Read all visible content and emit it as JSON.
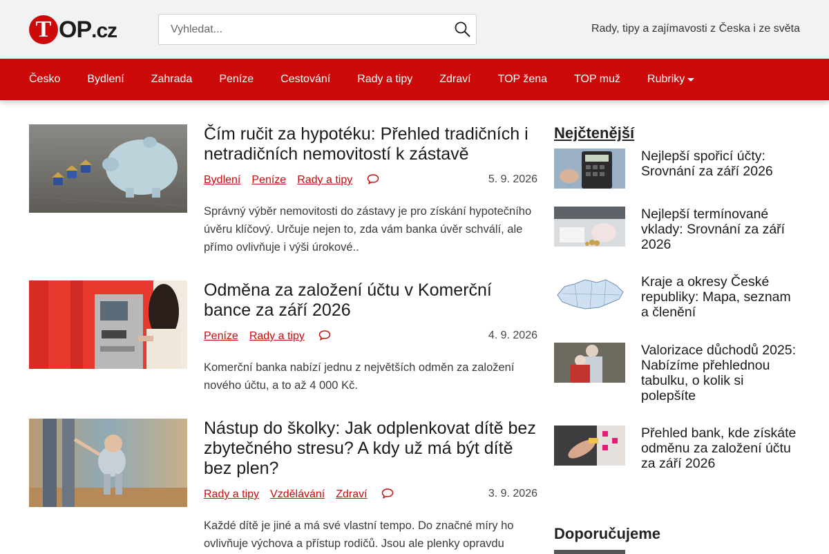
{
  "header": {
    "logo_letter": "T",
    "logo_text": "OP",
    "logo_suffix": ".cz",
    "search_placeholder": "Vyhledat...",
    "tagline": "Rady, tipy a zajímavosti z Česka i ze světa"
  },
  "nav": {
    "items": [
      "Česko",
      "Bydlení",
      "Zahrada",
      "Peníze",
      "Cestování",
      "Rady a tipy",
      "Zdraví",
      "TOP žena",
      "TOP muž",
      "Rubriky"
    ]
  },
  "articles": [
    {
      "title": "Čím ručit za hypotéku: Přehled tradičních i netradičních nemovitostí k zástavě",
      "categories": [
        "Bydlení",
        "Peníze",
        "Rady a tipy"
      ],
      "date": "5. 9. 2026",
      "excerpt": "Správný výběr nemovitosti do zástavy je pro získání hypotečního úvěru klíčový. Určuje nejen to, zda vám banka úvěr schválí, ale přímo ovlivňuje i výši úrokové.."
    },
    {
      "title": "Odměna za založení účtu v Komerční bance za září 2026",
      "categories": [
        "Peníze",
        "Rady a tipy"
      ],
      "date": "4. 9. 2026",
      "excerpt": "Komerční banka nabízí jednu z největších odměn za založení nového účtu, a to až 4 000 Kč."
    },
    {
      "title": "Nástup do školky: Jak odplenkovat dítě bez zbytečného stresu? A kdy už má být dítě bez plen?",
      "categories": [
        "Rady a tipy",
        "Vzdělávání",
        "Zdraví"
      ],
      "date": "3. 9. 2026",
      "excerpt": "Každé dítě je jiné a má své vlastní tempo. Do značné míry ho ovlivňuje výchova a přístup rodičů. Jsou ale plenky opravdu"
    }
  ],
  "sidebar": {
    "most_read_heading": "Nejčtenější",
    "most_read": [
      "Nejlepší spořicí účty: Srovnání za září 2026",
      "Nejlepší termínované vklady: Srovnání za září 2026",
      "Kraje a okresy České republiky: Mapa, seznam a členění",
      "Valorizace důchodů 2025: Nabízíme přehlednou tabulku, o kolik si polepšíte",
      "Přehled bank, kde získáte odměnu za založení účtu za září 2026"
    ],
    "recommended_heading": "Doporučujeme"
  },
  "colors": {
    "brand_red": "#cc0a0a",
    "header_bg": "#f2f2f2"
  }
}
